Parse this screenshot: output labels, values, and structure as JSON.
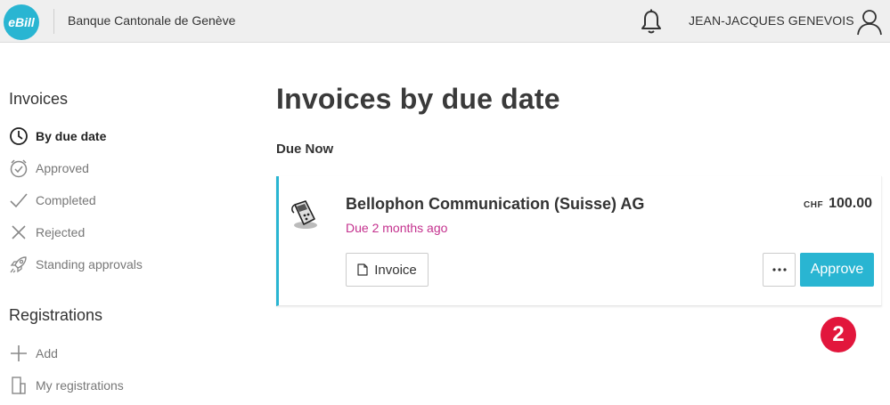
{
  "header": {
    "logo_text": "eBill",
    "bank_name": "Banque Cantonale de Genève",
    "user_name": "JEAN-JACQUES GENEVOIS",
    "icons": {
      "notifications": "bell-icon",
      "user": "user-icon"
    }
  },
  "sidebar": {
    "invoices_heading": "Invoices",
    "invoice_items": [
      {
        "label": "By due date",
        "icon": "clock-icon",
        "active": true
      },
      {
        "label": "Approved",
        "icon": "approved-clock-icon",
        "active": false
      },
      {
        "label": "Completed",
        "icon": "check-icon",
        "active": false
      },
      {
        "label": "Rejected",
        "icon": "x-icon",
        "active": false
      },
      {
        "label": "Standing approvals",
        "icon": "rocket-icon",
        "active": false
      }
    ],
    "registrations_heading": "Registrations",
    "registration_items": [
      {
        "label": "Add",
        "icon": "plus-icon"
      },
      {
        "label": "My registrations",
        "icon": "building-icon"
      }
    ]
  },
  "main": {
    "title": "Invoices by due date",
    "section_title": "Due Now",
    "invoice": {
      "biller_name": "Bellophon Communication (Suisse) AG",
      "due_text": "Due 2 months ago",
      "currency": "CHF",
      "amount": "100.00",
      "invoice_button": "Invoice",
      "more_button": "···",
      "approve_button": "Approve"
    },
    "step_badge": "2"
  },
  "colors": {
    "accent": "#29b5d2",
    "due_text": "#c4318e",
    "badge": "#e2163c",
    "header_bg": "#efefef"
  }
}
